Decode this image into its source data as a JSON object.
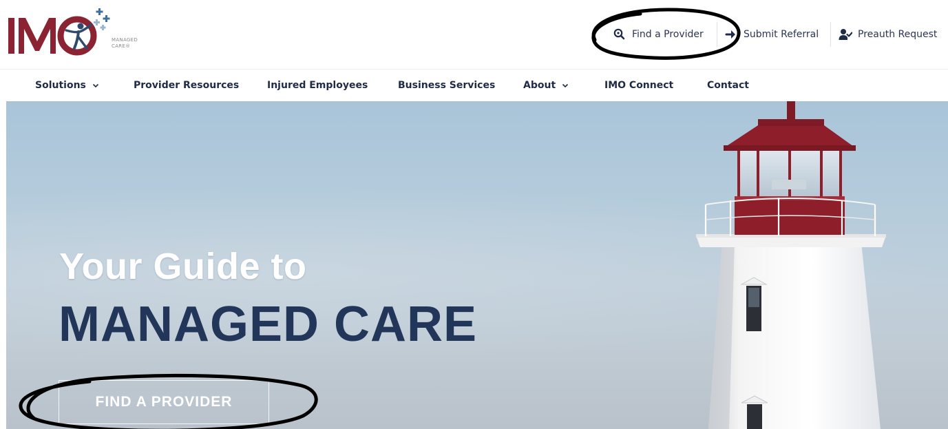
{
  "brand": {
    "name": "IMO",
    "subtitle_lines": [
      "MANAGED",
      "CARE®"
    ],
    "colors": {
      "maroon": "#8b2332",
      "plus_blue": "#3f6fa0",
      "navy": "#223659"
    }
  },
  "utility_nav": [
    {
      "icon": "search-icon",
      "label": "Find a Provider"
    },
    {
      "icon": "arrow-right-icon",
      "label": "Submit Referral"
    },
    {
      "icon": "user-check-icon",
      "label": "Preauth Request"
    }
  ],
  "main_nav": [
    {
      "label": "Solutions",
      "has_dropdown": true
    },
    {
      "label": "Provider Resources",
      "has_dropdown": false
    },
    {
      "label": "Injured Employees",
      "has_dropdown": false
    },
    {
      "label": "Business Services",
      "has_dropdown": false
    },
    {
      "label": "About",
      "has_dropdown": true
    },
    {
      "label": "IMO Connect",
      "has_dropdown": false
    },
    {
      "label": "Contact",
      "has_dropdown": false
    }
  ],
  "hero": {
    "line1": "Your Guide to",
    "line2": "MANAGED CARE",
    "button_label": "FIND A PROVIDER",
    "image": "lighthouse-photo"
  },
  "annotations": [
    "circle around Find a Provider link",
    "circle around FIND A PROVIDER button"
  ]
}
